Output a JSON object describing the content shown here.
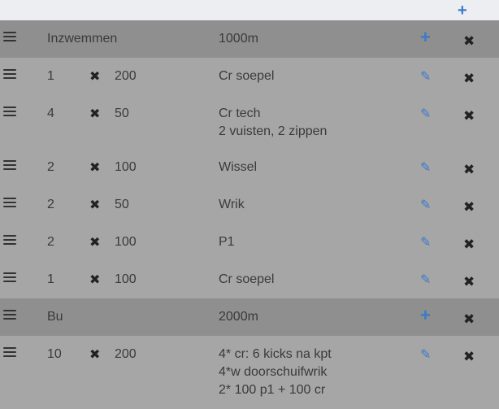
{
  "toolbar": {
    "add_icon": "plus-icon",
    "add_glyph": "+"
  },
  "glyphs": {
    "plus": "+",
    "times": "✖",
    "edit": "✎",
    "delete": "✖"
  },
  "colors": {
    "accent": "#3a7bc8",
    "group_bg": "#8f8f8f",
    "item_bg": "#a6a6a6",
    "top_bg": "#eceef2"
  },
  "groups": [
    {
      "name": "Inzwemmen",
      "total": "1000m",
      "items": [
        {
          "reps": "1",
          "distance": "200",
          "description": [
            "Cr soepel"
          ]
        },
        {
          "reps": "4",
          "distance": "50",
          "description": [
            "Cr tech",
            "2 vuisten, 2 zippen"
          ]
        },
        {
          "reps": "2",
          "distance": "100",
          "description": [
            "Wissel"
          ]
        },
        {
          "reps": "2",
          "distance": "50",
          "description": [
            "Wrik"
          ]
        },
        {
          "reps": "2",
          "distance": "100",
          "description": [
            "P1"
          ]
        },
        {
          "reps": "1",
          "distance": "100",
          "description": [
            "Cr soepel"
          ]
        }
      ]
    },
    {
      "name": "Bu",
      "total": "2000m",
      "items": [
        {
          "reps": "10",
          "distance": "200",
          "description": [
            "4* cr: 6 kicks na kpt",
            "4*w doorschuifwrik",
            "2* 100 p1 + 100 cr"
          ]
        }
      ]
    }
  ]
}
